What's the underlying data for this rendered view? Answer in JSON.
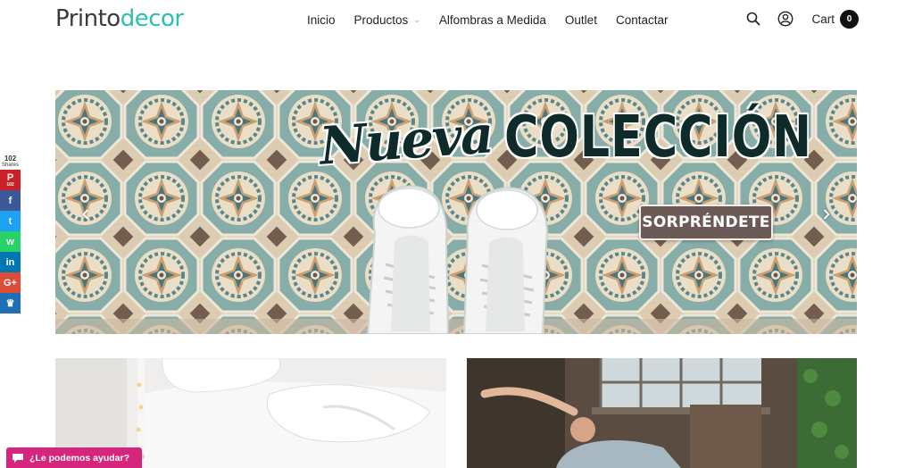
{
  "brand": {
    "part1": "Printo",
    "part2": "decor"
  },
  "nav": {
    "items": [
      {
        "label": "Inicio"
      },
      {
        "label": "Productos",
        "has_dropdown": true
      },
      {
        "label": "Alfombras a Medida"
      },
      {
        "label": "Outlet"
      },
      {
        "label": "Contactar"
      }
    ]
  },
  "header_icons": {
    "search": "search-icon",
    "account": "user-circle-icon"
  },
  "cart": {
    "label": "Cart",
    "count": "0"
  },
  "hero": {
    "script_text": "Nueva",
    "bold_text": "COLECCIÓN",
    "cta_label": "SORPRÉNDETE",
    "prev_icon": "chevron-left-icon",
    "next_icon": "chevron-right-icon"
  },
  "social": {
    "count": "102",
    "count_label": "Shares",
    "buttons": [
      {
        "name": "pinterest",
        "glyph": "P",
        "sub": "102",
        "color": "#cb2027"
      },
      {
        "name": "facebook",
        "glyph": "f",
        "color": "#3b5998"
      },
      {
        "name": "twitter",
        "glyph": "t",
        "color": "#1da1f2"
      },
      {
        "name": "whatsapp",
        "glyph": "w",
        "color": "#25d366"
      },
      {
        "name": "linkedin",
        "glyph": "in",
        "color": "#0077b5"
      },
      {
        "name": "googleplus",
        "glyph": "G+",
        "color": "#dd4b39"
      },
      {
        "name": "sumome",
        "glyph": "♛",
        "color": "#1e6fb5"
      }
    ]
  },
  "chat": {
    "label": "¿Le podemos ayudar?",
    "color": "#d6257c"
  },
  "colors": {
    "accent": "#2bbfb3",
    "cta": "#6b5a56",
    "text_dark": "#0e2b2a"
  }
}
